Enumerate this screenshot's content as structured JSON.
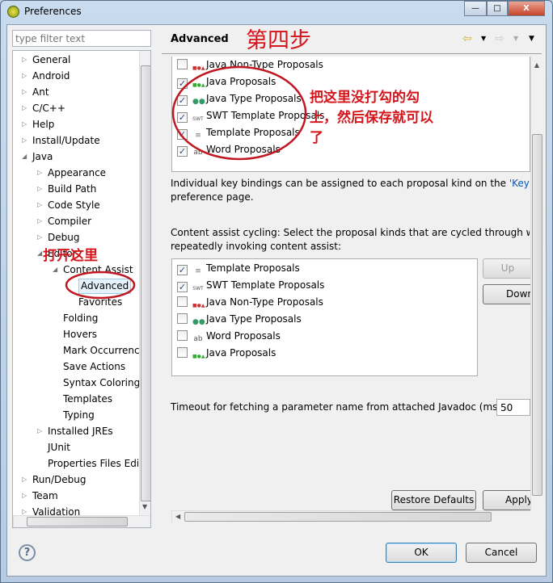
{
  "window": {
    "title": "Preferences",
    "min": "—",
    "max": "□",
    "close": "X"
  },
  "filter": {
    "placeholder": "type filter text"
  },
  "tree": [
    {
      "label": "General",
      "level": 0,
      "state": "collapsed"
    },
    {
      "label": "Android",
      "level": 0,
      "state": "collapsed"
    },
    {
      "label": "Ant",
      "level": 0,
      "state": "collapsed"
    },
    {
      "label": "C/C++",
      "level": 0,
      "state": "collapsed"
    },
    {
      "label": "Help",
      "level": 0,
      "state": "collapsed"
    },
    {
      "label": "Install/Update",
      "level": 0,
      "state": "collapsed"
    },
    {
      "label": "Java",
      "level": 0,
      "state": "expanded"
    },
    {
      "label": "Appearance",
      "level": 1,
      "state": "collapsed"
    },
    {
      "label": "Build Path",
      "level": 1,
      "state": "collapsed"
    },
    {
      "label": "Code Style",
      "level": 1,
      "state": "collapsed"
    },
    {
      "label": "Compiler",
      "level": 1,
      "state": "collapsed"
    },
    {
      "label": "Debug",
      "level": 1,
      "state": "collapsed"
    },
    {
      "label": "Editor",
      "level": 1,
      "state": "expanded"
    },
    {
      "label": "Content Assist",
      "level": 2,
      "state": "expanded"
    },
    {
      "label": "Advanced",
      "level": 3,
      "state": "leaf",
      "selected": true
    },
    {
      "label": "Favorites",
      "level": 3,
      "state": "leaf"
    },
    {
      "label": "Folding",
      "level": 2,
      "state": "leaf"
    },
    {
      "label": "Hovers",
      "level": 2,
      "state": "leaf"
    },
    {
      "label": "Mark Occurrences",
      "level": 2,
      "state": "leaf"
    },
    {
      "label": "Save Actions",
      "level": 2,
      "state": "leaf"
    },
    {
      "label": "Syntax Coloring",
      "level": 2,
      "state": "leaf"
    },
    {
      "label": "Templates",
      "level": 2,
      "state": "leaf"
    },
    {
      "label": "Typing",
      "level": 2,
      "state": "leaf"
    },
    {
      "label": "Installed JREs",
      "level": 1,
      "state": "collapsed"
    },
    {
      "label": "JUnit",
      "level": 1,
      "state": "leaf"
    },
    {
      "label": "Properties Files Editor",
      "level": 1,
      "state": "leaf"
    },
    {
      "label": "Run/Debug",
      "level": 0,
      "state": "collapsed"
    },
    {
      "label": "Team",
      "level": 0,
      "state": "collapsed"
    },
    {
      "label": "Validation",
      "level": 0,
      "state": "collapsed"
    }
  ],
  "page": {
    "title": "Advanced"
  },
  "default_proposals": [
    {
      "label": "Java Non-Type Proposals",
      "checked": false,
      "icon": "java-nontype-icon"
    },
    {
      "label": "Java Proposals",
      "checked": true,
      "icon": "java-icon"
    },
    {
      "label": "Java Type Proposals",
      "checked": true,
      "icon": "java-type-icon"
    },
    {
      "label": "SWT Template Proposals",
      "checked": true,
      "icon": "swt-icon"
    },
    {
      "label": "Template Proposals",
      "checked": true,
      "icon": "template-icon"
    },
    {
      "label": "Word Proposals",
      "checked": true,
      "icon": "word-icon"
    }
  ],
  "keys_note": {
    "before": "Individual key bindings can be assigned to each proposal kind on the ",
    "link": "'Keys'",
    "after": "preference page."
  },
  "cycling": {
    "label": "Content assist cycling: Select the proposal kinds that are cycled through whe",
    "label2": "repeatedly invoking content assist:",
    "items": [
      {
        "label": "Template Proposals",
        "checked": true,
        "icon": "template-icon"
      },
      {
        "label": "SWT Template Proposals",
        "checked": true,
        "icon": "swt-icon"
      },
      {
        "label": "Java Non-Type Proposals",
        "checked": false,
        "icon": "java-nontype-icon"
      },
      {
        "label": "Java Type Proposals",
        "checked": false,
        "icon": "java-type-icon"
      },
      {
        "label": "Word Proposals",
        "checked": false,
        "icon": "word-icon"
      },
      {
        "label": "Java Proposals",
        "checked": false,
        "icon": "java-icon"
      }
    ],
    "up": "Up",
    "down": "Down"
  },
  "timeout": {
    "label": "Timeout for fetching a parameter name from attached Javadoc (ms):",
    "value": "50"
  },
  "buttons": {
    "restore": "Restore Defaults",
    "apply": "Apply",
    "ok": "OK",
    "cancel": "Cancel"
  },
  "annotations": {
    "step": "第四步",
    "open_here": "打开这里",
    "instruction1": "把这里没打勾的勾",
    "instruction2": "上，然后保存就可以",
    "instruction3": "了"
  },
  "colors": {
    "annotation": "#d4151b",
    "link": "#0a59b8",
    "selection": "#e5f1fb"
  }
}
